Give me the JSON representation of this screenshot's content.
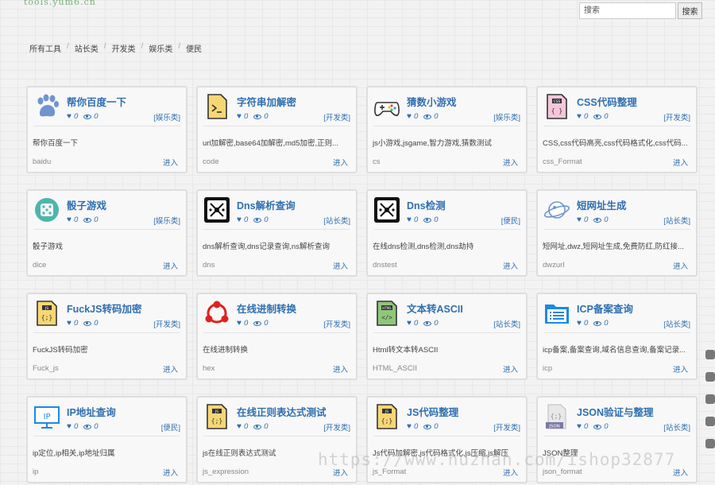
{
  "header": {
    "logo_text": "tools.yum6.cn",
    "search_placeholder": "搜索",
    "search_button": "搜索"
  },
  "breadcrumb": [
    "所有工具",
    "站长类",
    "开发类",
    "娱乐类",
    "便民"
  ],
  "cards": [
    {
      "title": "帮你百度一下",
      "likes": "0",
      "views": "0",
      "tag": "[娱乐类]",
      "desc": "帮你百度一下",
      "slug": "baidu",
      "enter": "进入",
      "icon": "paw-icon"
    },
    {
      "title": "字符串加解密",
      "likes": "0",
      "views": "0",
      "tag": "[开发类]",
      "desc": "url加解密,base64加解密,md5加密,正则...",
      "slug": "code",
      "enter": "进入",
      "icon": "terminal-doc-icon"
    },
    {
      "title": "猜数小游戏",
      "likes": "0",
      "views": "0",
      "tag": "[娱乐类]",
      "desc": "js小游戏,jsgame,智力游戏,猜数测试",
      "slug": "cs",
      "enter": "进入",
      "icon": "gamepad-icon"
    },
    {
      "title": "CSS代码整理",
      "likes": "0",
      "views": "0",
      "tag": "[开发类]",
      "desc": "CSS,css代码高亮,css代码格式化,css代码...",
      "slug": "css_Format",
      "enter": "进入",
      "icon": "css-file-icon"
    },
    {
      "title": "骰子游戏",
      "likes": "0",
      "views": "0",
      "tag": "[娱乐类]",
      "desc": "骰子游戏",
      "slug": "dice",
      "enter": "进入",
      "icon": "dice-icon"
    },
    {
      "title": "Dns解析查询",
      "likes": "0",
      "views": "0",
      "tag": "[站长类]",
      "desc": "dns解析查询,dns记录查询,ns解析查询",
      "slug": "dns",
      "enter": "进入",
      "icon": "network-icon"
    },
    {
      "title": "Dns检测",
      "likes": "0",
      "views": "0",
      "tag": "[便民]",
      "desc": "在线dns检测,dns检测,dns劫持",
      "slug": "dnstest",
      "enter": "进入",
      "icon": "network-icon"
    },
    {
      "title": "短网址生成",
      "likes": "0",
      "views": "0",
      "tag": "[站长类]",
      "desc": "短网址,dwz,短网址生成,免费防红,防红接...",
      "slug": "dwzurl",
      "enter": "进入",
      "icon": "planet-icon"
    },
    {
      "title": "FuckJS转码加密",
      "likes": "0",
      "views": "0",
      "tag": "[开发类]",
      "desc": "FuckJS转码加密",
      "slug": "Fuck_js",
      "enter": "进入",
      "icon": "js-file-icon"
    },
    {
      "title": "在线进制转换",
      "likes": "0",
      "views": "0",
      "tag": "[开发类]",
      "desc": "在线进制转换",
      "slug": "hex",
      "enter": "进入",
      "icon": "hub-icon"
    },
    {
      "title": "文本转ASCII",
      "likes": "0",
      "views": "0",
      "tag": "[站长类]",
      "desc": "Html转文本转ASCII",
      "slug": "HTML_ASCII",
      "enter": "进入",
      "icon": "html-file-icon"
    },
    {
      "title": "ICP备案查询",
      "likes": "0",
      "views": "0",
      "tag": "[站长类]",
      "desc": "icp备案,备案查询,域名信息查询,备案记录...",
      "slug": "icp",
      "enter": "进入",
      "icon": "folder-list-icon"
    },
    {
      "title": "IP地址查询",
      "likes": "0",
      "views": "0",
      "tag": "[便民]",
      "desc": "ip定位,ip相关,ip地址归属",
      "slug": "ip",
      "enter": "进入",
      "icon": "ip-monitor-icon"
    },
    {
      "title": "在线正则表达式测试",
      "likes": "0",
      "views": "0",
      "tag": "[开发类]",
      "desc": "js在线正则表达式测试",
      "slug": "js_expression",
      "enter": "进入",
      "icon": "js-file-icon"
    },
    {
      "title": "JS代码整理",
      "likes": "0",
      "views": "0",
      "tag": "[开发类]",
      "desc": "Js代码加解密,js代码格式化,js压缩,js解压",
      "slug": "js_Format",
      "enter": "进入",
      "icon": "js-file-icon"
    },
    {
      "title": "JSON验证与整理",
      "likes": "0",
      "views": "0",
      "tag": "[站长类]",
      "desc": "JSON整理",
      "slug": "json_format",
      "enter": "进入",
      "icon": "json-file-icon"
    }
  ],
  "watermark": "https://www.huzhan.com/ishop32877"
}
